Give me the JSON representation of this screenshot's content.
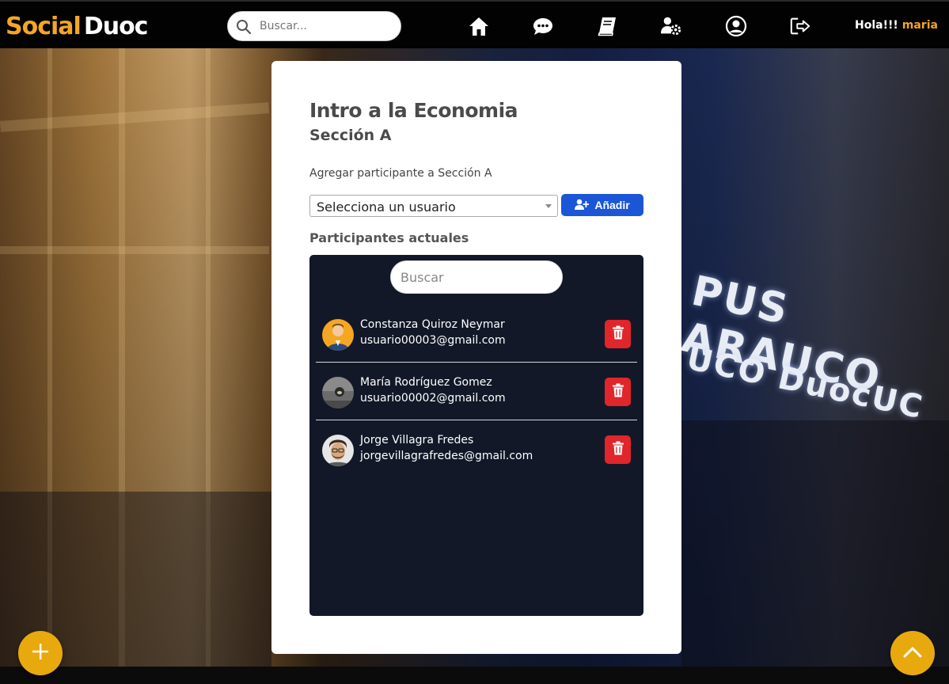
{
  "brand": {
    "part1": "Social",
    "part2": "Duoc"
  },
  "top_search": {
    "placeholder": "Buscar..."
  },
  "nav": {
    "icons": [
      "home-icon",
      "chat-icon",
      "book-icon",
      "user-cog-icon",
      "profile-icon",
      "logout-icon"
    ],
    "greeting": "Hola!!!",
    "username": "maria"
  },
  "card": {
    "title": "Intro a la Economia",
    "subtitle": "Sección A",
    "add_label": "Agregar participante a Sección A",
    "select_value": "Selecciona un usuario",
    "add_button": "Añadir",
    "participants_label": "Participantes actuales",
    "search_placeholder": "Buscar"
  },
  "participants": [
    {
      "name": "Constanza Quiroz Neymar",
      "email": "usuario00003@gmail.com"
    },
    {
      "name": "María Rodríguez Gomez",
      "email": "usuario00002@gmail.com"
    },
    {
      "name": "Jorge Villagra Fredes",
      "email": "jorgevillagrafredes@gmail.com"
    }
  ],
  "background_sign": {
    "line1": "PUS ARAUCO",
    "line2": "UCO DuocUC"
  },
  "colors": {
    "accent": "#f5a623",
    "primary": "#1a56d6",
    "danger": "#e0252b",
    "panel": "#121828",
    "fab": "#e8a90f"
  }
}
